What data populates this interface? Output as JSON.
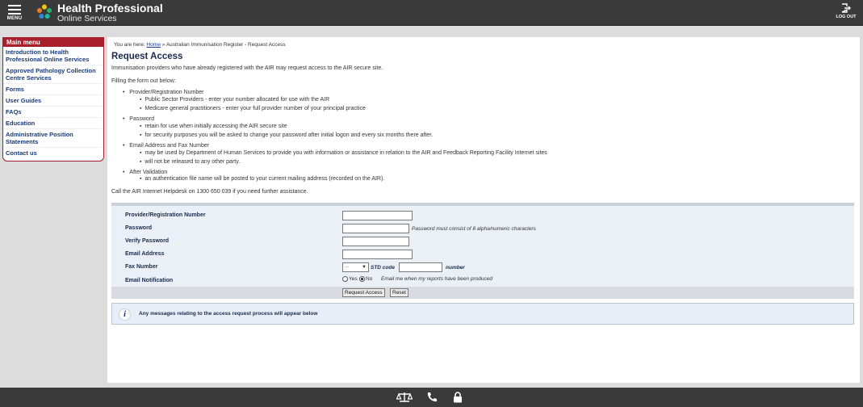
{
  "header": {
    "menu_label": "MENU",
    "brand_line1": "Health Professional",
    "brand_line2": "Online Services",
    "logout_label": "LOG OUT"
  },
  "sidebar": {
    "title": "Main menu",
    "items": [
      {
        "label": "Introduction to Health Professional Online Services"
      },
      {
        "label": "Approved Pathology Collection Centre Services"
      },
      {
        "label": "Forms"
      },
      {
        "label": "User Guides"
      },
      {
        "label": "FAQs"
      },
      {
        "label": "Education"
      },
      {
        "label": "Administrative Position Statements"
      },
      {
        "label": "Contact us"
      }
    ]
  },
  "breadcrumb": {
    "prefix": "You are here:",
    "home": "Home",
    "separator": "»",
    "current": "Australian Immunisation Register - Request Access"
  },
  "page": {
    "title": "Request Access",
    "intro": "Immunisation providers who have already registered with the AIR may request access to the AIR secure site.",
    "filling": "Filling the form out below:",
    "sections": [
      {
        "heading": "Provider/Registration Number",
        "points": [
          "Public Sector Providers - enter your number allocated for use with the AIR",
          "Medicare general practitioners - enter your full provider number of your principal practice"
        ]
      },
      {
        "heading": "Password",
        "points": [
          "retain for use when initially accessing the AIR secure site",
          "for security purposes you will be asked to change your password after initial logon and every six months there after."
        ]
      },
      {
        "heading": "Email Address and Fax Number",
        "points": [
          "may be used by Department of Human Services to provide you with information or assistance in relation to the AIR and Feedback Reporting Facility Internet sites",
          "will not be released to any other party."
        ]
      },
      {
        "heading": "After Validation",
        "points": [
          "an authentication file name will be posted to your current mailing address (recorded on the AIR)."
        ]
      }
    ],
    "helpdesk": "Call the AIR Internet Helpdesk on 1300 650 039 if you need further assistance."
  },
  "form": {
    "provider_label": "Provider/Registration Number",
    "password_label": "Password",
    "password_hint": "Password must consist of 8 alpha/numeric characters",
    "verify_label": "Verify Password",
    "email_label": "Email Address",
    "fax_label": "Fax Number",
    "fax_select_value": "...",
    "std_label": "STD code",
    "number_label": "number",
    "notify_label": "Email Notification",
    "yes_label": "Yes",
    "no_label": "No",
    "notify_hint": "Email me when my reports have been produced",
    "submit_label": "Request Access",
    "reset_label": "Reset"
  },
  "message": {
    "text": "Any messages relating to the access request process will appear below"
  }
}
